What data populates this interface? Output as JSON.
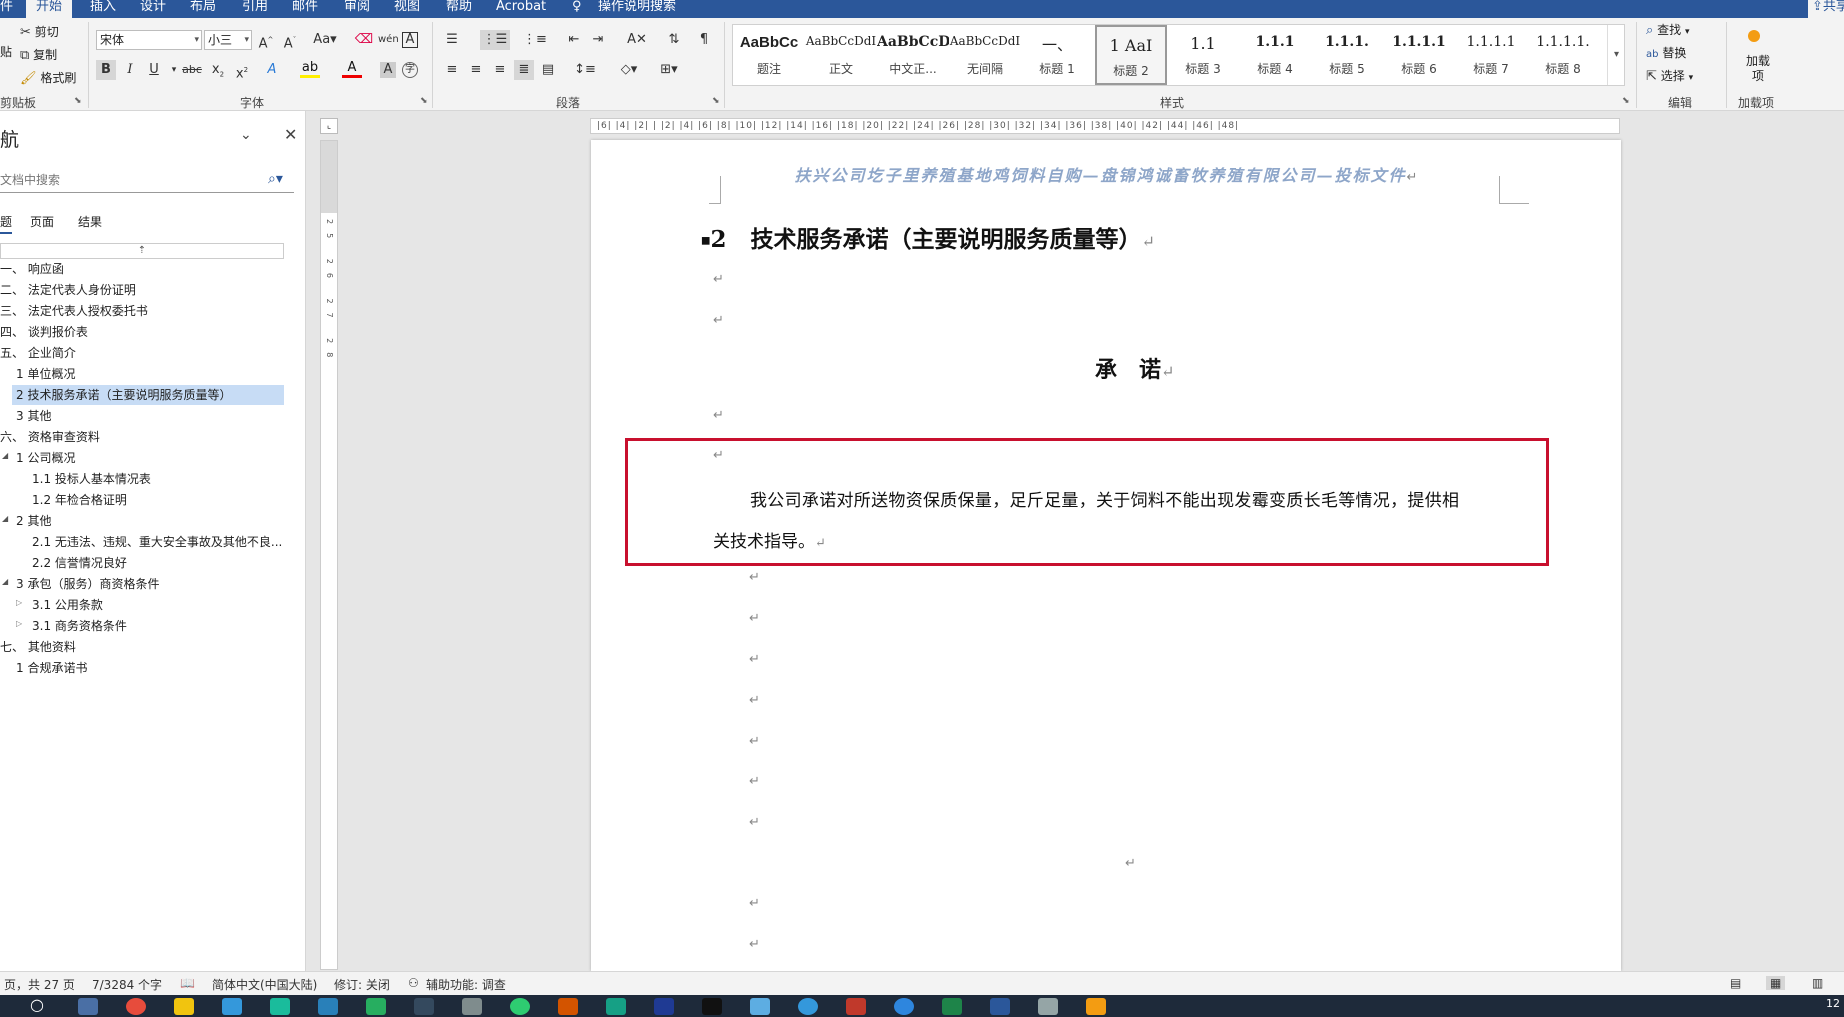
{
  "tabs": {
    "file": "件",
    "home": "开始",
    "insert": "插入",
    "design": "设计",
    "layout": "布局",
    "references": "引用",
    "mailings": "邮件",
    "review": "审阅",
    "view": "视图",
    "help": "帮助",
    "acrobat": "Acrobat",
    "tellme": "操作说明搜索",
    "share": "共享"
  },
  "ribbon": {
    "clipboard": {
      "cut": "剪切",
      "copy": "复制",
      "format_painter": "格式刷",
      "paste": "贴",
      "label": "剪贴板"
    },
    "font": {
      "name": "宋体",
      "size": "小三",
      "label": "字体"
    },
    "paragraph": {
      "label": "段落"
    },
    "styles": {
      "label": "样式",
      "items": [
        {
          "preview": "AaBbCc",
          "name": "题注"
        },
        {
          "preview": "AaBbCcDdI",
          "name": "正文"
        },
        {
          "preview": "AaBbCcD",
          "name": "中文正..."
        },
        {
          "preview": "AaBbCcDdI",
          "name": "无间隔"
        },
        {
          "preview": "一、",
          "name": "标题 1"
        },
        {
          "preview": "1   AaI",
          "name": "标题 2"
        },
        {
          "preview": "1.1",
          "name": "标题 3"
        },
        {
          "preview": "1.1.1",
          "name": "标题 4"
        },
        {
          "preview": "1.1.1.",
          "name": "标题 5"
        },
        {
          "preview": "1.1.1.1",
          "name": "标题 6"
        },
        {
          "preview": "1.1.1.1",
          "name": "标题 7"
        },
        {
          "preview": "1.1.1.1.",
          "name": "标题 8"
        }
      ]
    },
    "editing": {
      "find": "查找",
      "replace": "替换",
      "select": "选择",
      "label": "编辑"
    },
    "addins": {
      "button": "加载项",
      "label": "加载项"
    }
  },
  "nav": {
    "title": "航",
    "search_placeholder": "文档中搜索",
    "tabs": [
      "题",
      "页面",
      "结果"
    ],
    "items": [
      "一、 响应函",
      "二、 法定代表人身份证明",
      "三、 法定代表人授权委托书",
      "四、 谈判报价表",
      "五、 企业简介",
      "1 单位概况",
      "2 技术服务承诺（主要说明服务质量等）",
      "3 其他",
      "六、 资格审查资料",
      "1 公司概况",
      "1.1 投标人基本情况表",
      "1.2 年检合格证明",
      "2 其他",
      "2.1 无违法、违规、重大安全事故及其他不良...",
      "2.2 信誉情况良好",
      "3 承包（服务）商资格条件",
      "3.1 公用条款",
      "3.1 商务资格条件",
      "七、 其他资料",
      "1 合规承诺书"
    ]
  },
  "document": {
    "header": "扶兴公司圪子里养殖基地鸡饲料自购—盘锦鸿诚畜牧养殖有限公司—投标文件",
    "heading_number": "2",
    "heading": "技术服务承诺（主要说明服务质量等）",
    "promise_title": "承　诺",
    "body_line1": "我公司承诺对所送物资保质保量，足斤足量，关于饲料不能出现发霉变质长毛等情况，提供相",
    "body_line2": "关技术指导。"
  },
  "status": {
    "page": "页，共 27 页",
    "words": "7/3284 个字",
    "language": "简体中文(中国大陆)",
    "track": "修订: 关闭",
    "accessibility": "辅助功能: 调查"
  },
  "taskbar": {
    "clock": "12"
  },
  "colors": {
    "accent": "#2b579a",
    "highlight_box": "#c8102e",
    "nav_selected": "#c7dcf5",
    "header_text": "#8ea6c9"
  }
}
